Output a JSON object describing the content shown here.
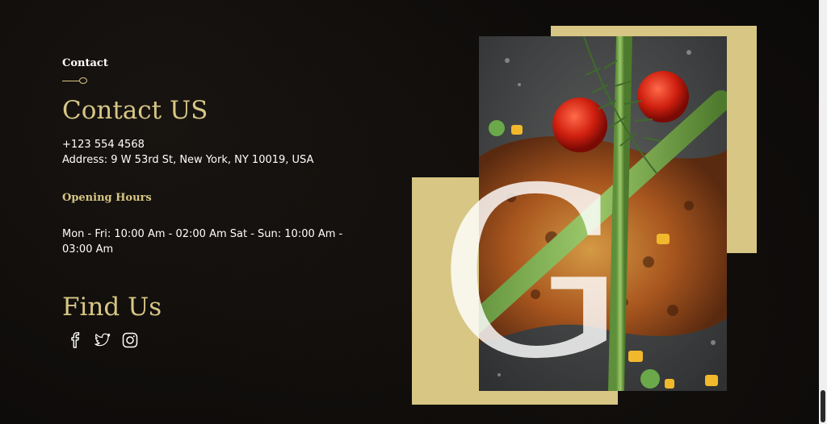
{
  "contact": {
    "eyebrow": "Contact",
    "title": "Contact US",
    "phone": "+123 554 4568",
    "address": "Address: 9 W 53rd St, New York, NY 10019, USA",
    "hours_title": "Opening Hours",
    "hours": "Mon - Fri: 10:00 Am - 02:00 Am Sat - Sun: 10:00 Am - 03:00 Am"
  },
  "find_us": {
    "title": "Find Us",
    "icons": [
      "facebook-icon",
      "twitter-icon",
      "instagram-icon"
    ]
  },
  "decor": {
    "letter": "G"
  },
  "colors": {
    "accent": "#d7c684",
    "background": "#0c0a09",
    "text": "#ffffff"
  }
}
